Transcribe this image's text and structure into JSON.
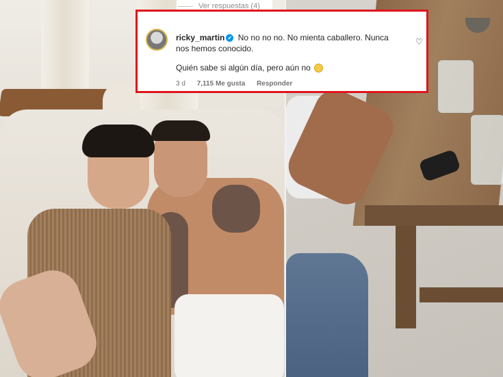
{
  "comment": {
    "replies_label": "Ver respuestas (4)",
    "username": "ricky_martin",
    "verified_glyph": "✔",
    "line1": "No no no no. No mienta caballero. Nunca nos hemos conocido.",
    "line2": "Quién sabe si algún día, pero aún no",
    "emoji": "slightly-smiling-face",
    "time": "3 d",
    "likes": "7,115 Me gusta",
    "reply_label": "Responder",
    "highlight_color": "#e0141c",
    "verified_color": "#0095f6"
  },
  "icons": {
    "like": "heart-outline-icon"
  }
}
